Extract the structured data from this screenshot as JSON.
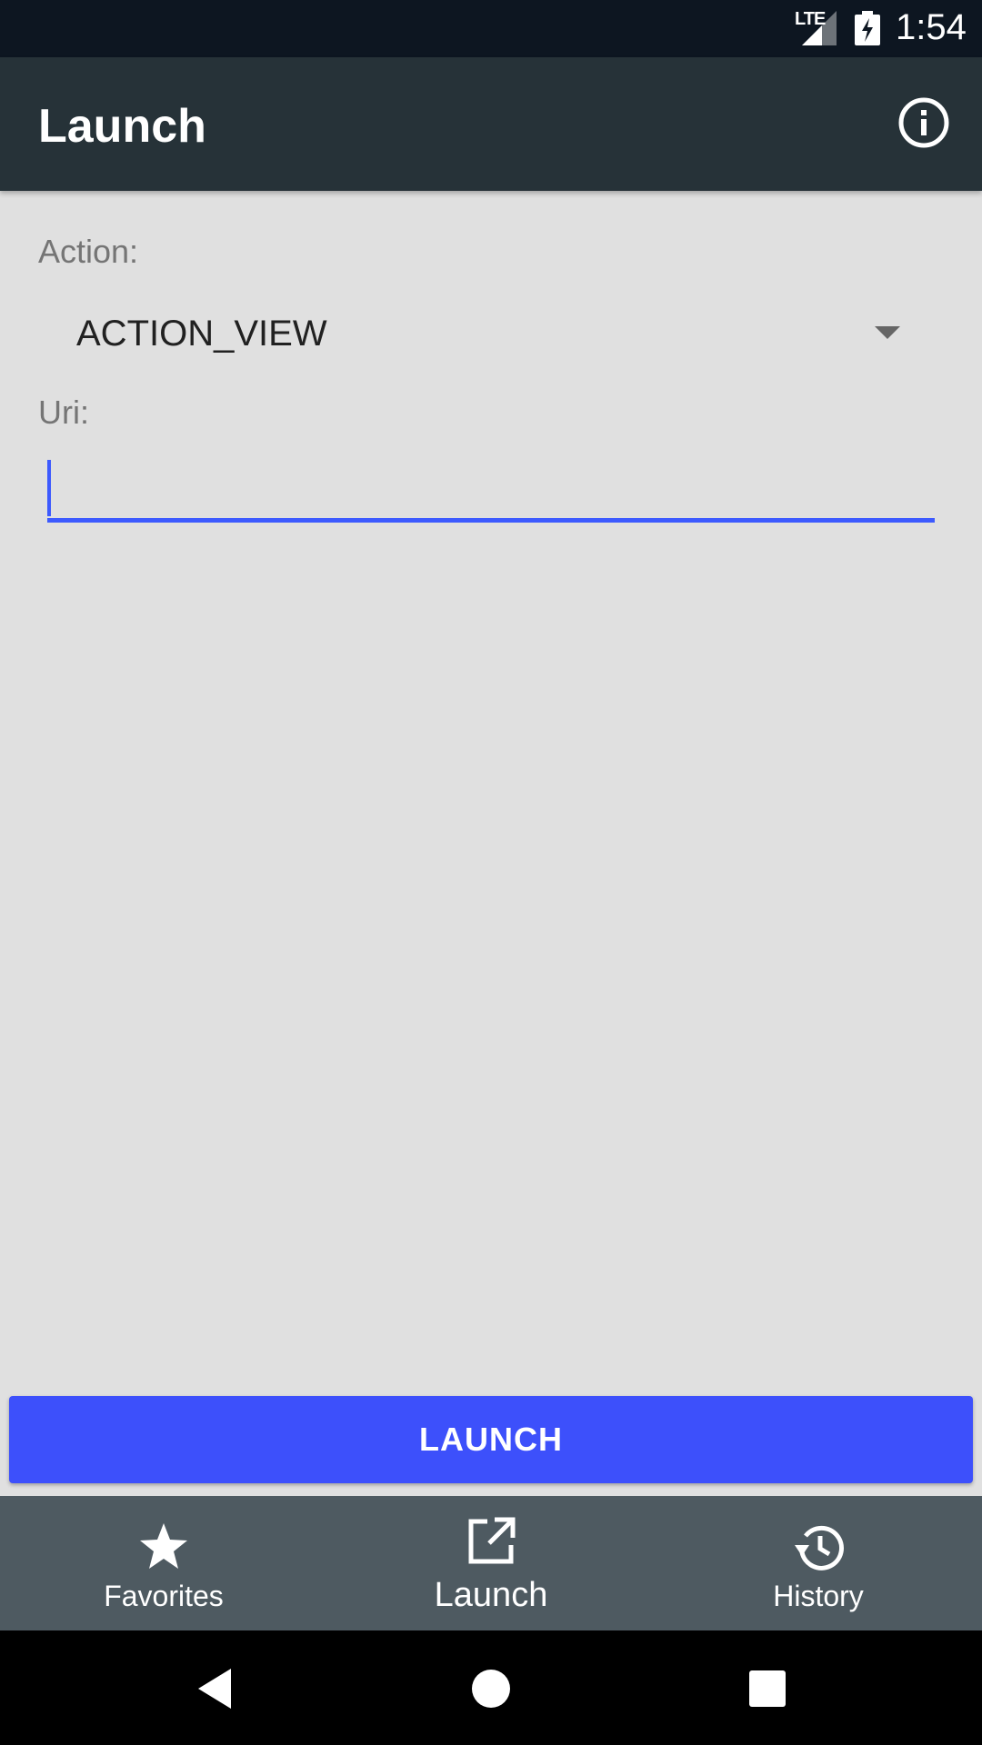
{
  "status_bar": {
    "network": "LTE",
    "time": "1:54",
    "icons": [
      "signal-icon",
      "battery-charging-icon"
    ]
  },
  "app_bar": {
    "title": "Launch",
    "info_icon": "info-icon"
  },
  "form": {
    "action_label": "Action:",
    "action_value": "ACTION_VIEW",
    "uri_label": "Uri:",
    "uri_value": ""
  },
  "launch_button": {
    "label": "LAUNCH"
  },
  "bottom_nav": {
    "items": [
      {
        "label": "Favorites",
        "icon": "star-icon"
      },
      {
        "label": "Launch",
        "icon": "open-external-icon",
        "selected": true
      },
      {
        "label": "History",
        "icon": "history-icon"
      }
    ]
  },
  "colors": {
    "accent": "#3d5afe",
    "app_bar": "#263238",
    "bottom_nav": "#4e5a61",
    "background": "#e0e0e0"
  }
}
